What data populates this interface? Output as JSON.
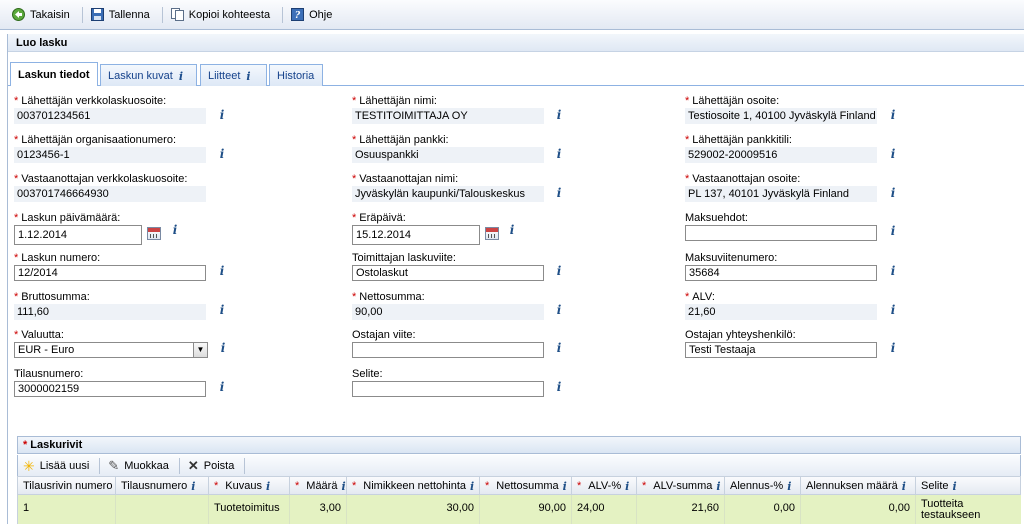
{
  "toolbar": {
    "back": "Takaisin",
    "save": "Tallenna",
    "copy": "Kopioi kohteesta",
    "help": "Ohje"
  },
  "panel": {
    "title": "Luo lasku"
  },
  "tabs": [
    {
      "label": "Laskun tiedot",
      "active": true
    },
    {
      "label": "Laskun kuvat",
      "has_info": true
    },
    {
      "label": "Liitteet",
      "has_info": true
    },
    {
      "label": "Historia"
    }
  ],
  "form": {
    "sender_einvoice_address": {
      "label": "Lähettäjän verkkolaskuosoite:",
      "value": "003701234561",
      "required": true
    },
    "sender_name": {
      "label": "Lähettäjän nimi:",
      "value": "TESTITOIMITTAJA OY",
      "required": true
    },
    "sender_address": {
      "label": "Lähettäjän osoite:",
      "value": "Testiosoite 1, 40100 Jyväskylä Finland",
      "required": true
    },
    "sender_org_number": {
      "label": "Lähettäjän organisaationumero:",
      "value": "0123456-1",
      "required": true
    },
    "sender_bank": {
      "label": "Lähettäjän pankki:",
      "value": "Osuuspankki",
      "required": true
    },
    "sender_bank_account": {
      "label": "Lähettäjän pankkitili:",
      "value": "529002-20009516",
      "required": true
    },
    "recipient_einvoice_address": {
      "label": "Vastaanottajan verkkolaskuosoite:",
      "value": "003701746664930",
      "required": true
    },
    "recipient_name": {
      "label": "Vastaanottajan nimi:",
      "value": "Jyväskylän kaupunki/Talouskeskus",
      "required": true
    },
    "recipient_address": {
      "label": "Vastaanottajan osoite:",
      "value": "PL 137, 40101 Jyväskylä Finland",
      "required": true
    },
    "invoice_date": {
      "label": "Laskun päivämäärä:",
      "value": "1.12.2014",
      "required": true
    },
    "due_date": {
      "label": "Eräpäivä:",
      "value": "15.12.2014",
      "required": true
    },
    "payment_terms": {
      "label": "Maksuehdot:",
      "value": ""
    },
    "invoice_number": {
      "label": "Laskun numero:",
      "value": "12/2014",
      "required": true
    },
    "supplier_reference": {
      "label": "Toimittajan laskuviite:",
      "value": "Ostolaskut"
    },
    "payment_reference": {
      "label": "Maksuviitenumero:",
      "value": "35684"
    },
    "gross_amount": {
      "label": "Bruttosumma:",
      "value": "111,60",
      "required": true
    },
    "net_amount": {
      "label": "Nettosumma:",
      "value": "90,00",
      "required": true
    },
    "vat": {
      "label": "ALV:",
      "value": "21,60",
      "required": true
    },
    "currency": {
      "label": "Valuutta:",
      "value": "EUR - Euro",
      "required": true
    },
    "buyer_reference": {
      "label": "Ostajan viite:",
      "value": ""
    },
    "buyer_contact": {
      "label": "Ostajan yhteyshenkilö:",
      "value": "Testi Testaaja"
    },
    "order_number": {
      "label": "Tilausnumero:",
      "value": "3000002159"
    },
    "description": {
      "label": "Selite:",
      "value": ""
    }
  },
  "info_glyph": "i",
  "required_mark": "*",
  "grid": {
    "title": "Laskurivit",
    "toolbar": {
      "add": "Lisää uusi",
      "edit": "Muokkaa",
      "delete": "Poista"
    },
    "columns": [
      {
        "label": "Tilausrivin numero"
      },
      {
        "label": "Tilausnumero",
        "info": true
      },
      {
        "label": "Kuvaus",
        "info": true,
        "required": true
      },
      {
        "label": "Määrä",
        "info": true,
        "required": true
      },
      {
        "label": "Nimikkeen nettohinta",
        "info": true,
        "required": true
      },
      {
        "label": "Nettosumma",
        "info": true,
        "required": true
      },
      {
        "label": "ALV-%",
        "info": true,
        "required": true
      },
      {
        "label": "ALV-summa",
        "info": true,
        "required": true
      },
      {
        "label": "Alennus-%",
        "info": true
      },
      {
        "label": "Alennuksen määrä",
        "info": true
      },
      {
        "label": "Selite",
        "info": true
      }
    ],
    "rows": [
      [
        "1",
        "",
        "Tuotetoimitus",
        "3,00",
        "30,00",
        "90,00",
        "24,00",
        "21,60",
        "0,00",
        "0,00",
        "Tuotteita testaukseen"
      ]
    ]
  },
  "colors": {
    "accent": "#15428b",
    "row_selected": "#e4f2c2",
    "required": "#cc0000"
  }
}
